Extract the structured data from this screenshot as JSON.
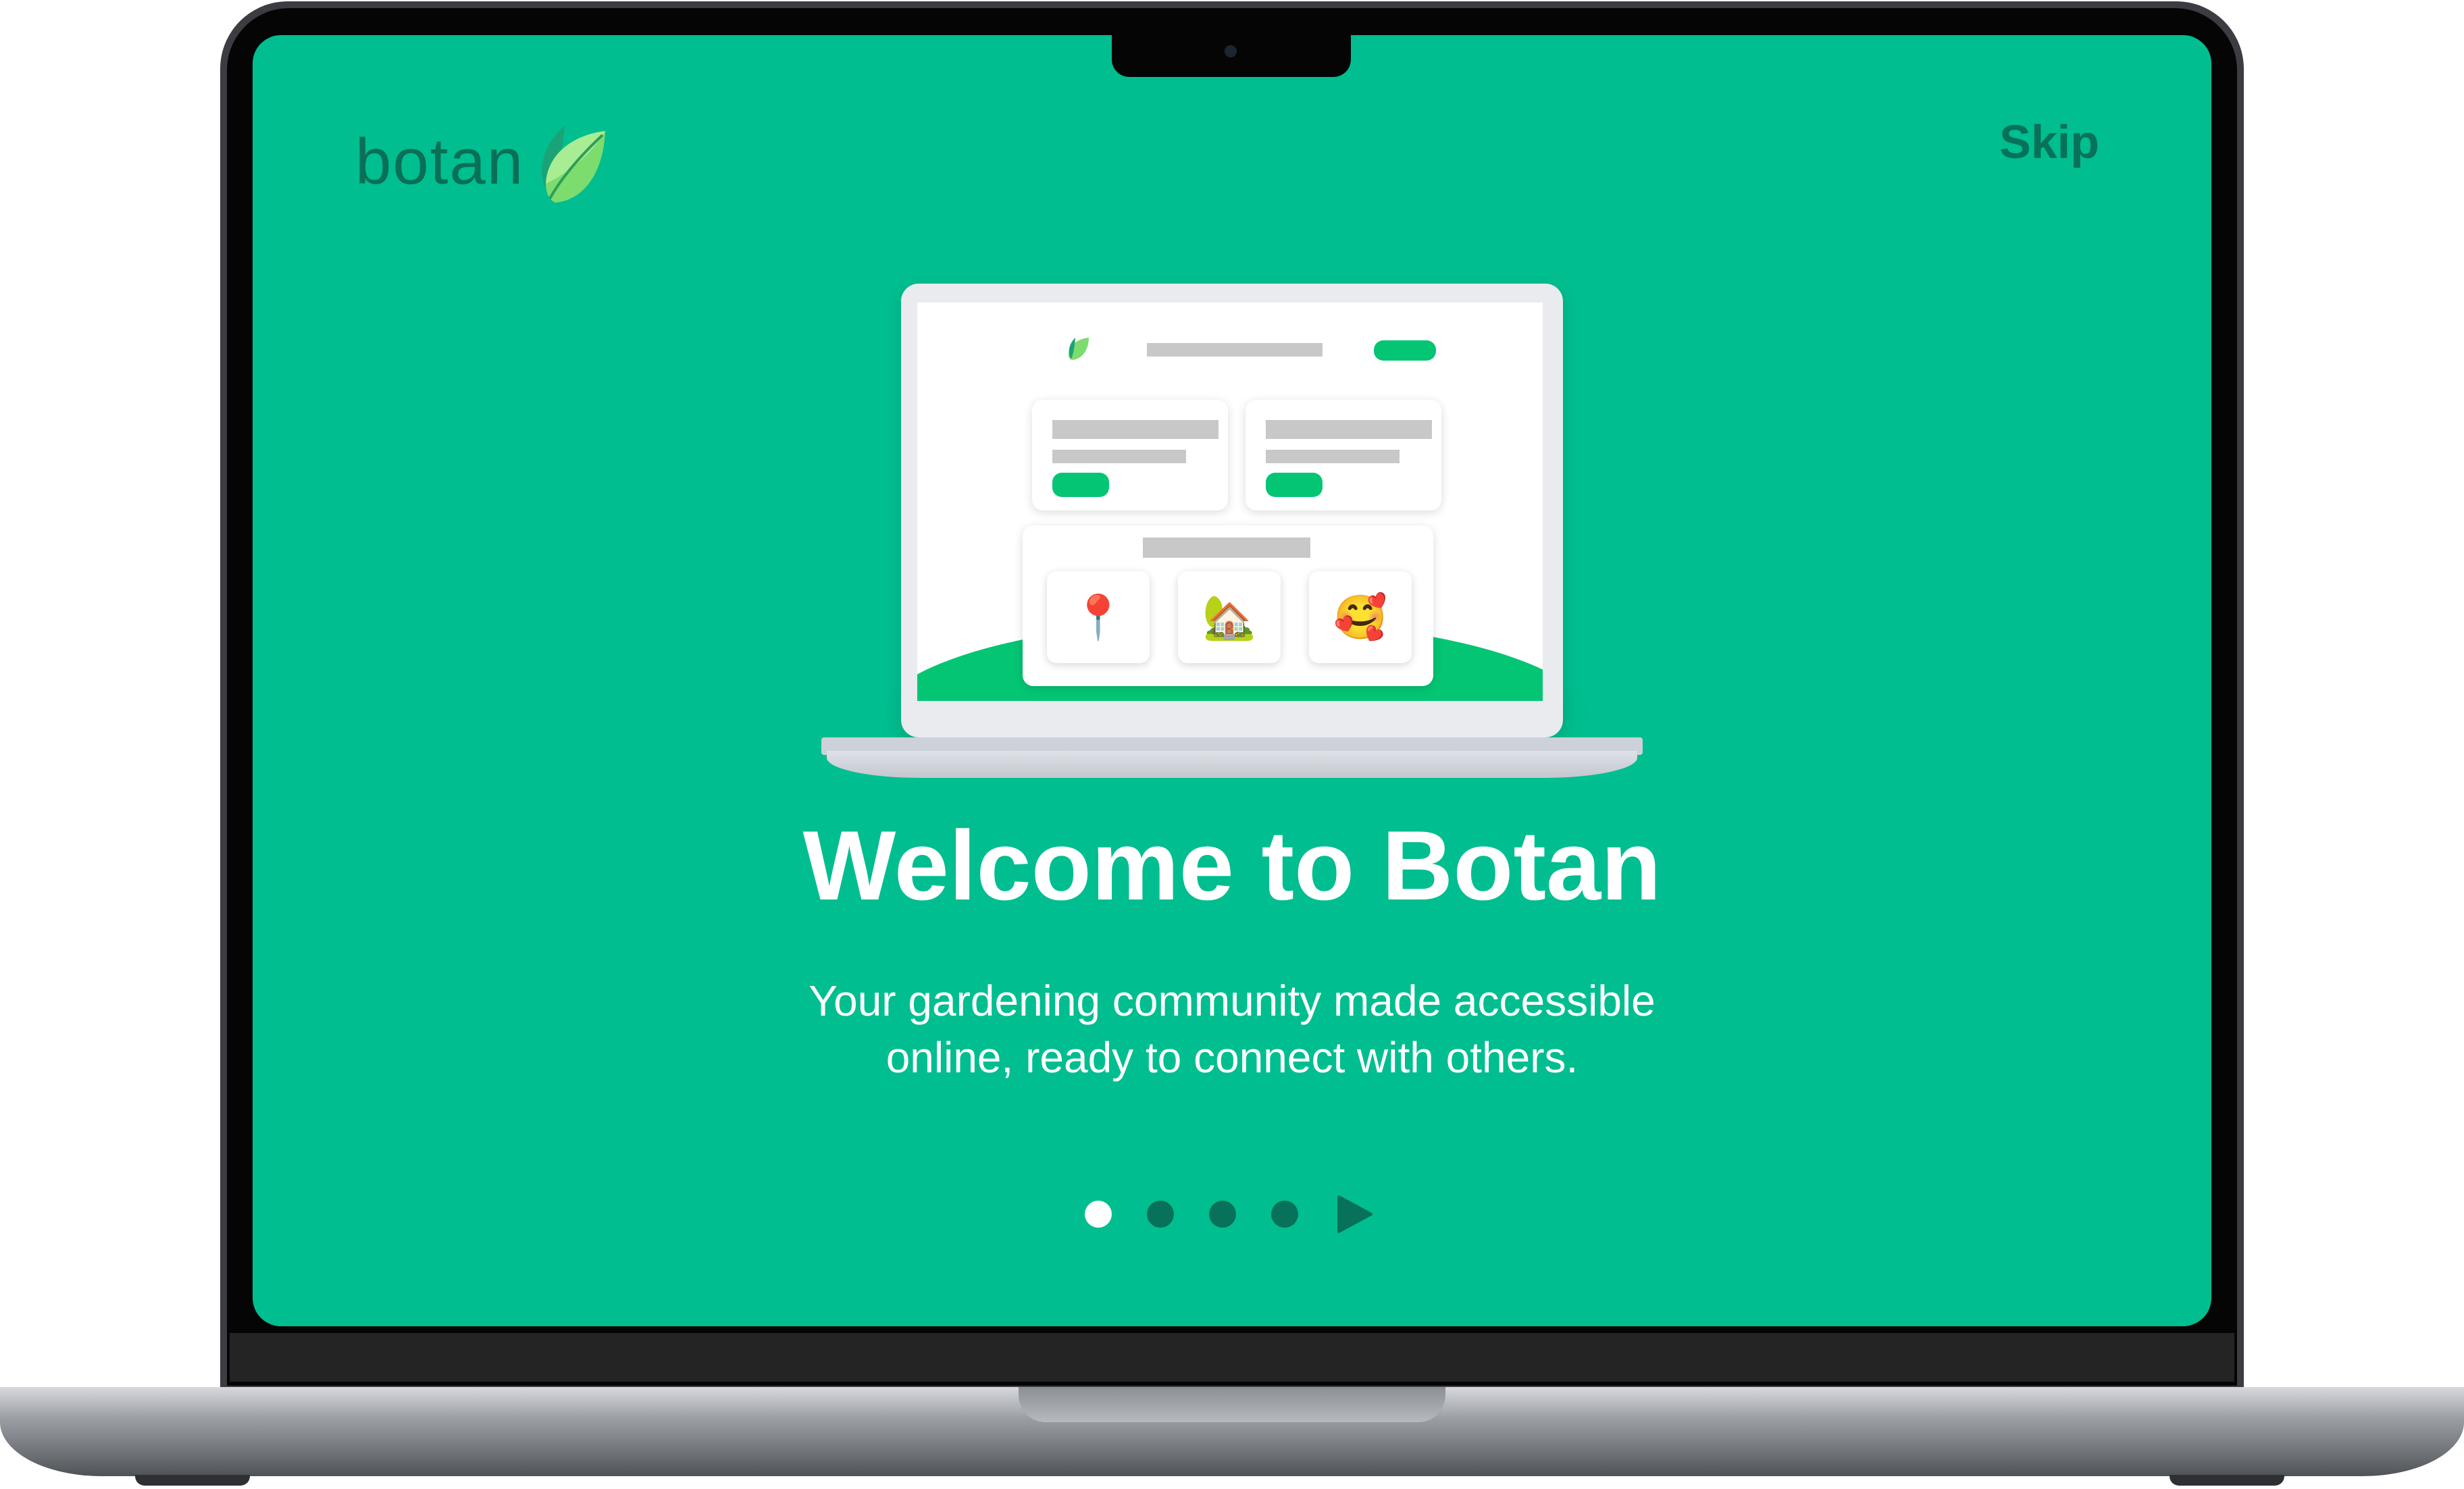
{
  "app": {
    "brand_name": "botan",
    "skip_label": "Skip"
  },
  "welcome": {
    "title": "Welcome to Botan",
    "subtitle_line1": "Your gardening community made accessible",
    "subtitle_line2": "online, ready to connect with others."
  },
  "illustration": {
    "emojis": [
      "📍",
      "🏡",
      "🥰"
    ]
  },
  "pager": {
    "total_dots": 4,
    "active_index": 0,
    "next_icon": "play-arrow-icon"
  },
  "colors": {
    "screen_bg": "#00be8f",
    "brand_dark": "#087159",
    "accent_green": "#04c574",
    "text_white": "#ffffff"
  }
}
